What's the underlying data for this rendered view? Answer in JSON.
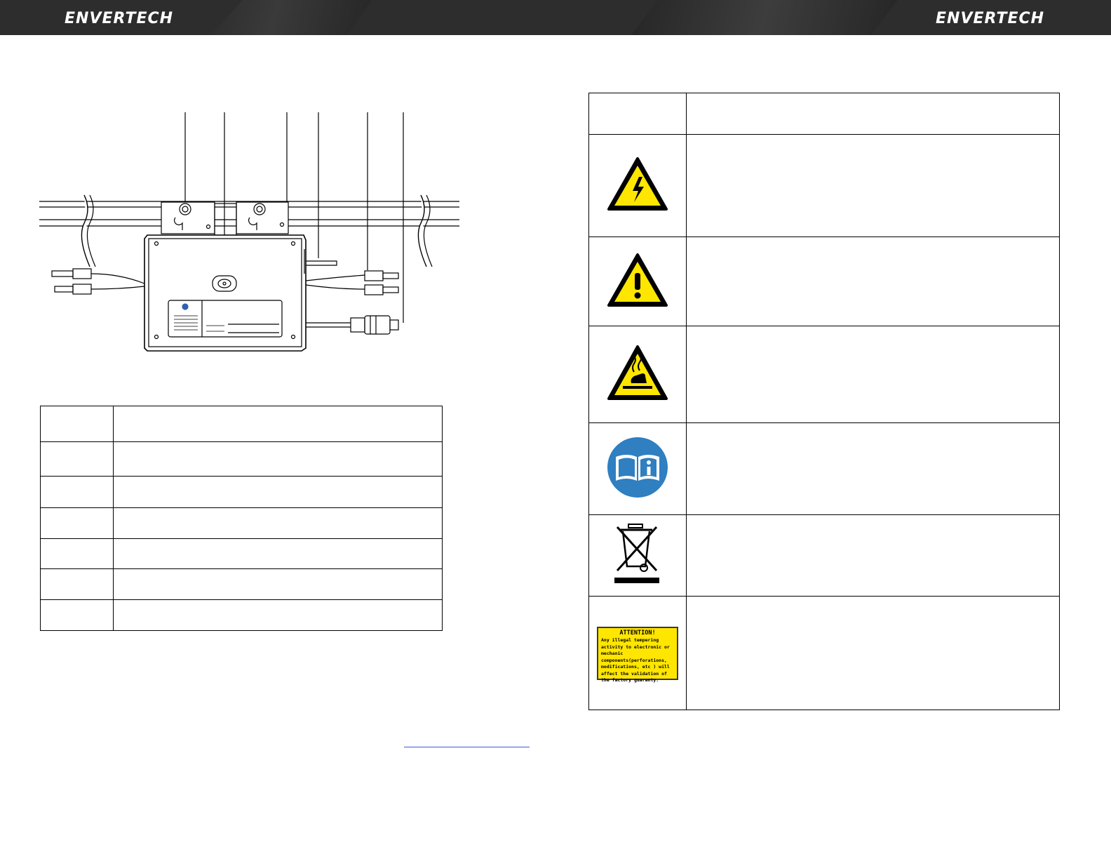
{
  "header": {
    "brand_left": "ENVERTECH",
    "brand_right": "ENVERTECH"
  },
  "colors": {
    "header_bg": "#2d2d2d",
    "warning_yellow": "#ffe600",
    "info_blue": "#2f7fc1",
    "link_blue": "#3b5bdb"
  },
  "left_table": {
    "rows": [
      "",
      "",
      "",
      "",
      "",
      "",
      ""
    ]
  },
  "right_table": {
    "rows": [
      {
        "icon": "none",
        "text": ""
      },
      {
        "icon": "electric-shock-warning-icon",
        "text": ""
      },
      {
        "icon": "general-warning-icon",
        "text": ""
      },
      {
        "icon": "hot-surface-warning-icon",
        "text": ""
      },
      {
        "icon": "read-manual-icon",
        "text": ""
      },
      {
        "icon": "weee-crossed-bin-icon",
        "text": ""
      },
      {
        "icon": "attention-label-icon",
        "text": ""
      }
    ]
  },
  "attention_label": {
    "title": "ATTENTION!",
    "body": "Any illegal tempering activity to electronic or mechanic components(perforations, modifications, etc ) will affect the validation of the factory guaranty."
  }
}
